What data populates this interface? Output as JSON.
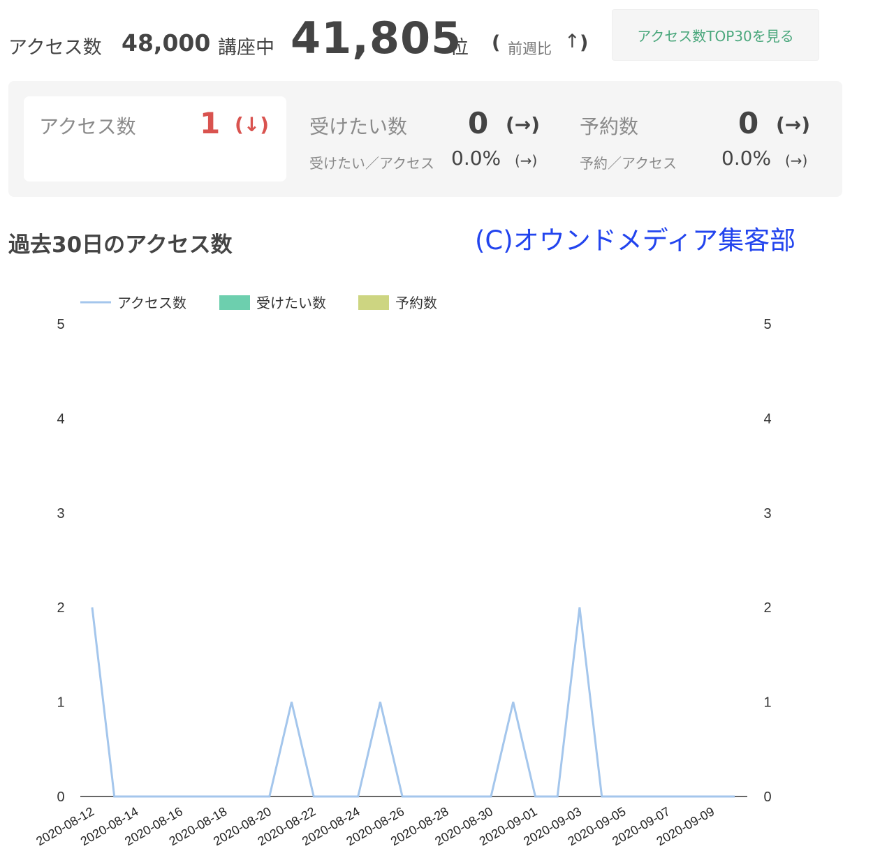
{
  "header": {
    "access_label": "アクセス数",
    "total_courses": "48,000",
    "courses_suffix": "講座中",
    "rank": "41,805",
    "rank_suffix": "位",
    "paren_open": "(",
    "week_label": "前週比",
    "week_arrow": "↑",
    "paren_close": ")",
    "top30_button": "アクセス数TOP30を見る"
  },
  "stats": {
    "access": {
      "label": "アクセス数",
      "value": "1",
      "change": "(↓)"
    },
    "want": {
      "label": "受けたい数",
      "value": "0",
      "change": "(→)",
      "ratio_label": "受けたい／アクセス",
      "ratio": "0.0%",
      "ratio_change": "(→)"
    },
    "reserve": {
      "label": "予約数",
      "value": "0",
      "change": "(→)",
      "ratio_label": "予約／アクセス",
      "ratio": "0.0%",
      "ratio_change": "(→)"
    }
  },
  "section_title": "過去30日のアクセス数",
  "copyright": "(C)オウンドメディア集客部",
  "colors": {
    "access_line": "#a4c6ec",
    "want": "#6dcfae",
    "reserve": "#cdd581",
    "accent_red": "#d9534f",
    "button_green": "#4aa77c",
    "copyright_blue": "#2244ee"
  },
  "chart_data": {
    "type": "line",
    "legend": [
      "アクセス数",
      "受けたい数",
      "予約数"
    ],
    "legend_position": "top-left",
    "grid": false,
    "ylim": [
      0,
      5
    ],
    "y_ticks": [
      0,
      1,
      2,
      3,
      4,
      5
    ],
    "y2_ticks": [
      0,
      1,
      2,
      3,
      4,
      5
    ],
    "x_tick_labels": [
      "2020-08-12",
      "2020-08-14",
      "2020-08-16",
      "2020-08-18",
      "2020-08-20",
      "2020-08-22",
      "2020-08-24",
      "2020-08-26",
      "2020-08-28",
      "2020-08-30",
      "2020-09-01",
      "2020-09-03",
      "2020-09-05",
      "2020-09-07",
      "2020-09-09"
    ],
    "x": [
      "2020-08-12",
      "2020-08-13",
      "2020-08-14",
      "2020-08-15",
      "2020-08-16",
      "2020-08-17",
      "2020-08-18",
      "2020-08-19",
      "2020-08-20",
      "2020-08-21",
      "2020-08-22",
      "2020-08-23",
      "2020-08-24",
      "2020-08-25",
      "2020-08-26",
      "2020-08-27",
      "2020-08-28",
      "2020-08-29",
      "2020-08-30",
      "2020-08-31",
      "2020-09-01",
      "2020-09-02",
      "2020-09-03",
      "2020-09-04",
      "2020-09-05",
      "2020-09-06",
      "2020-09-07",
      "2020-09-08",
      "2020-09-09",
      "2020-09-10"
    ],
    "series": [
      {
        "name": "アクセス数",
        "values": [
          2,
          0,
          0,
          0,
          0,
          0,
          0,
          0,
          0,
          1,
          0,
          0,
          0,
          1,
          0,
          0,
          0,
          0,
          0,
          1,
          0,
          0,
          2,
          0,
          0,
          0,
          0,
          0,
          0,
          0
        ]
      },
      {
        "name": "受けたい数",
        "values": [
          0,
          0,
          0,
          0,
          0,
          0,
          0,
          0,
          0,
          0,
          0,
          0,
          0,
          0,
          0,
          0,
          0,
          0,
          0,
          0,
          0,
          0,
          0,
          0,
          0,
          0,
          0,
          0,
          0,
          0
        ]
      },
      {
        "name": "予約数",
        "values": [
          0,
          0,
          0,
          0,
          0,
          0,
          0,
          0,
          0,
          0,
          0,
          0,
          0,
          0,
          0,
          0,
          0,
          0,
          0,
          0,
          0,
          0,
          0,
          0,
          0,
          0,
          0,
          0,
          0,
          0
        ]
      }
    ]
  }
}
